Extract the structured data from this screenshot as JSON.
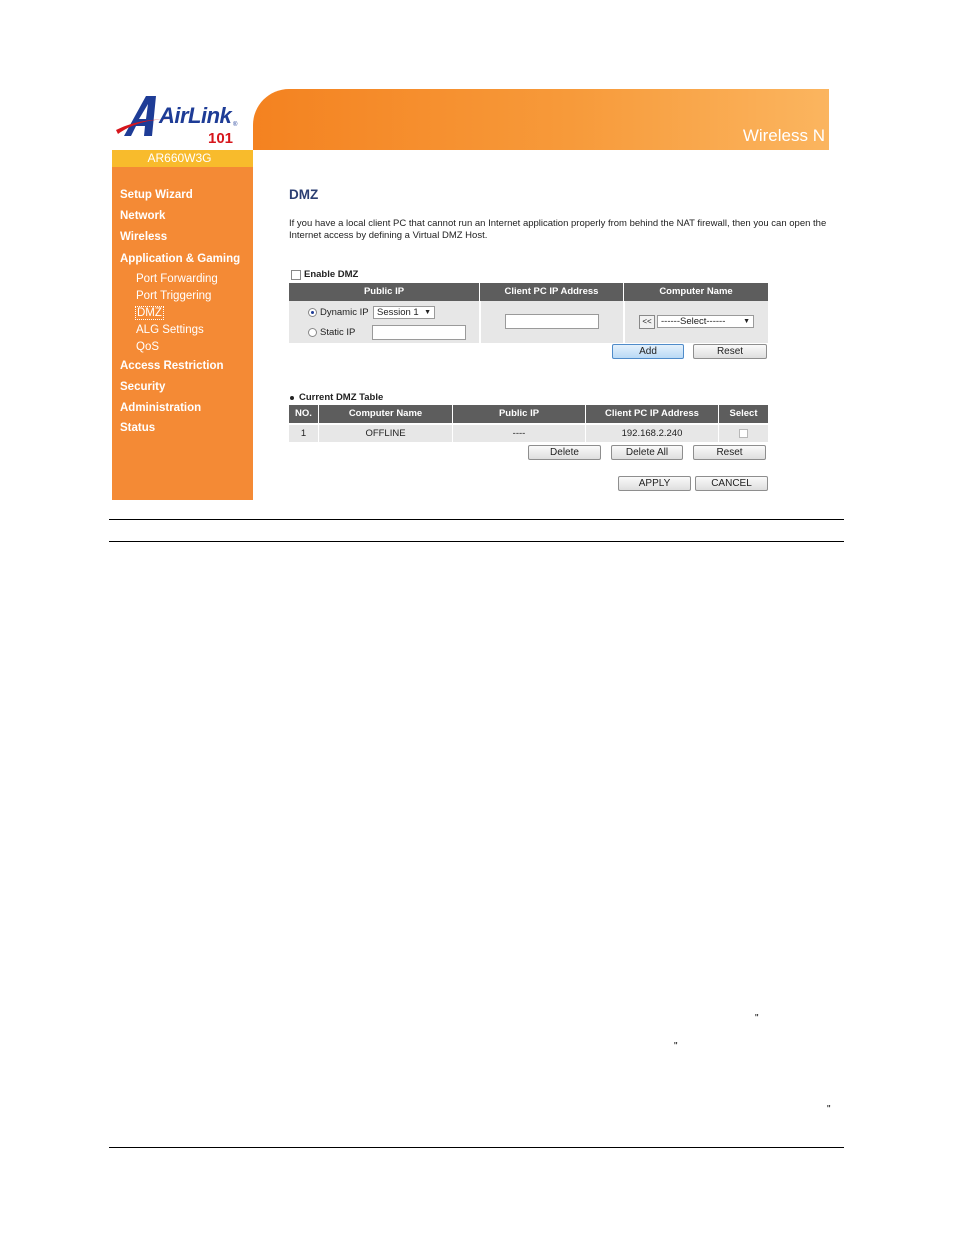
{
  "brand": {
    "logo_name": "AirLink",
    "logo_number": "101",
    "logo_reg": "®",
    "banner_text": "Wireless N",
    "model": "AR660W3G"
  },
  "sidebar": {
    "items": [
      {
        "label": "Setup Wizard"
      },
      {
        "label": "Network"
      },
      {
        "label": "Wireless"
      },
      {
        "label": "Application & Gaming"
      },
      {
        "label": "Access Restriction"
      },
      {
        "label": "Security"
      },
      {
        "label": "Administration"
      },
      {
        "label": "Status"
      }
    ],
    "subitems": [
      {
        "label": "Port Forwarding"
      },
      {
        "label": "Port Triggering"
      },
      {
        "label": "DMZ"
      },
      {
        "label": "ALG Settings"
      },
      {
        "label": "QoS"
      }
    ],
    "active": "DMZ"
  },
  "main": {
    "title": "DMZ",
    "description": "If you have a local client PC that cannot run an Internet application properly from behind the NAT firewall, then you can open the Internet access by defining a Virtual DMZ Host.",
    "enable_label": "Enable DMZ",
    "form": {
      "headers": [
        "Public IP",
        "Client PC IP Address",
        "Computer Name"
      ],
      "dynamic_ip_label": "Dynamic IP",
      "session_value": "Session 1",
      "static_ip_label": "Static IP",
      "copy_button": "<<",
      "computer_select_value": "------Select------",
      "add_button": "Add",
      "reset_button": "Reset"
    },
    "table": {
      "label": "Current DMZ Table",
      "headers": [
        "NO.",
        "Computer Name",
        "Public IP",
        "Client PC IP Address",
        "Select"
      ],
      "rows": [
        {
          "no": "1",
          "computer_name": "OFFLINE",
          "public_ip": "----",
          "client_ip": "192.168.2.240"
        }
      ],
      "delete_button": "Delete",
      "delete_all_button": "Delete All",
      "reset_button": "Reset"
    },
    "apply_button": "APPLY",
    "cancel_button": "CANCEL"
  },
  "document": {
    "quote_marks": [
      "\"",
      "\"",
      "\""
    ]
  }
}
